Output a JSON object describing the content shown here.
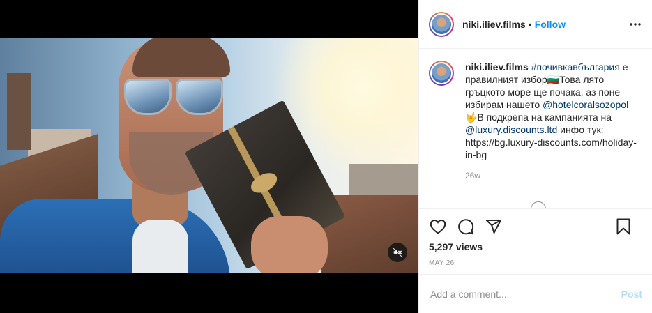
{
  "header": {
    "username": "niki.iliev.films",
    "separator": "•",
    "follow_label": "Follow",
    "more_icon": "more-horizontal-icon"
  },
  "caption": {
    "username": "niki.iliev.films",
    "hashtag": "#почивкавбългария",
    "part1": " е правилният избор",
    "flag_emoji": "🇧🇬",
    "part2": "Това лято гръцкото море ще почака, аз поне избирам нашето ",
    "mention1": "@hotelcoralsozopol",
    "hand_emoji": "🤟",
    "part3": "В подкрепа на кампанията на ",
    "mention2": "@luxury.discounts.ltd",
    "part4": " инфо тук: https://bg.luxury-discounts.com/holiday-in-bg",
    "age": "26w"
  },
  "actions": {
    "like_icon": "heart-icon",
    "comment_icon": "comment-icon",
    "share_icon": "paper-plane-icon",
    "save_icon": "bookmark-icon",
    "views": "5,297 views",
    "date": "MAY 26"
  },
  "add_comment": {
    "placeholder": "Add a comment...",
    "post_label": "Post"
  },
  "video": {
    "mute_icon": "speaker-muted-icon"
  },
  "colors": {
    "accent": "#0095f6",
    "link": "#00376b",
    "post_disabled": "#b2dffc",
    "muted": "#8e8e8e"
  }
}
